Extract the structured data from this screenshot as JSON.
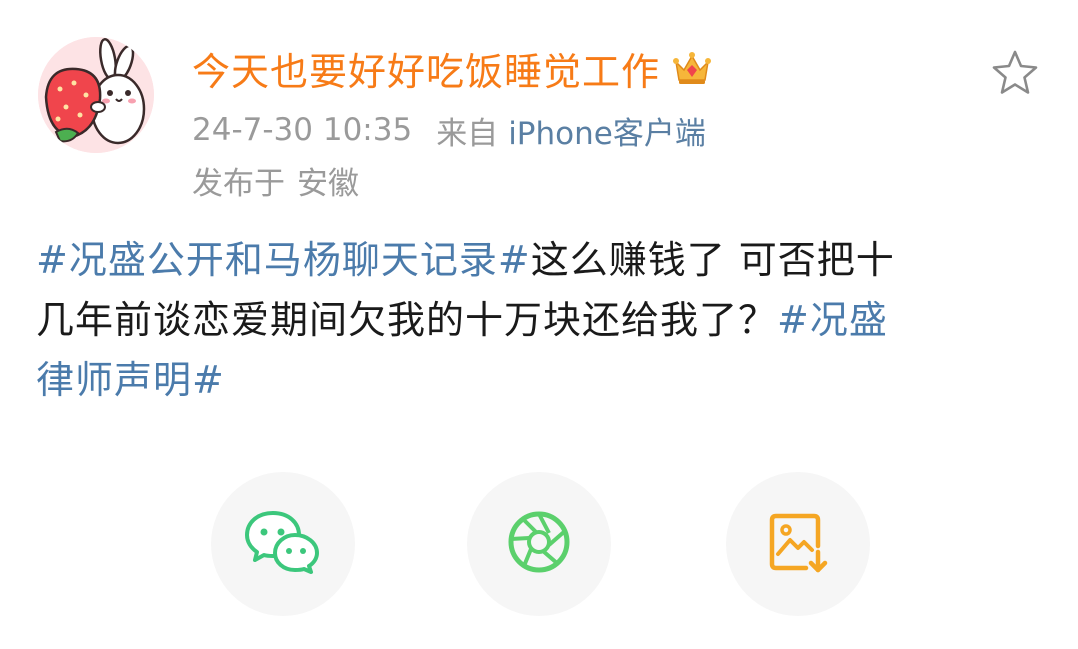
{
  "post": {
    "username": "今天也要好好吃饭睡觉工作",
    "time": "24-7-30 10:35",
    "source_prefix": "来自",
    "source_device": "iPhone客户端",
    "location_prefix": "发布于",
    "location": "安徽",
    "body": {
      "line1_tag": "#况盛公开和马杨聊天记录#",
      "line1_text": "这么赚钱了 可否把十",
      "line2_text": "几年前谈恋爱期间欠我的十万块还给我了？",
      "line2_tag": "#况盛",
      "line3_tag": "律师声明#"
    }
  },
  "icons": {
    "avatar": "strawberry-bunny-avatar",
    "badge": "crown-icon",
    "favorite": "star-icon",
    "share_wechat": "wechat-icon",
    "share_moments": "moments-aperture-icon",
    "save_image": "save-image-icon"
  },
  "colors": {
    "username": "#f77b17",
    "hashtag": "#4b7bab",
    "device": "#5a7fa3",
    "meta": "#9a9a9a",
    "wechat": "#3cc77c",
    "moments": "#5bd06c",
    "save": "#f5a623"
  }
}
